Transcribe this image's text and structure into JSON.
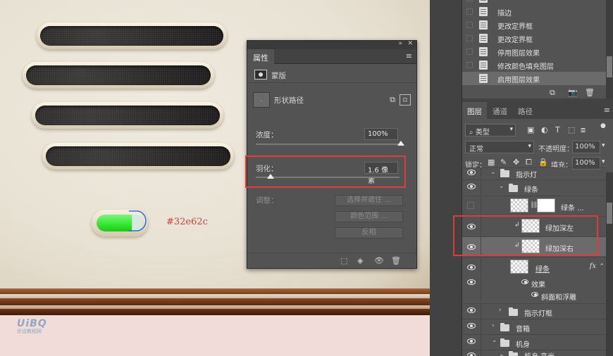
{
  "canvas": {
    "color_label": "#32e62c",
    "indicator_fill_color": "#32e62c",
    "indicator_level_percent": 75,
    "watermark": {
      "line1": "UiBQ",
      "line2": "优设教程网"
    }
  },
  "properties_panel": {
    "collapse_icon": "»",
    "close_icon": "✕",
    "tab_label": "属性",
    "section_label": "蒙版",
    "shape_thumb_label": ".",
    "shape_path_label": "形状路径",
    "density_label": "浓度：",
    "density_value": "100%",
    "density_level_percent": 100,
    "feather_label": "羽化：",
    "feather_value": "1.6 像素",
    "feather_level_percent": 10,
    "adjust_label": "调整：",
    "btn_select_mask": "选择并遮住 ...",
    "btn_color_range": "颜色范围 ...",
    "btn_invert": "反相"
  },
  "history_panel": {
    "items": [
      {
        "label": "描边"
      },
      {
        "label": "更改定界框"
      },
      {
        "label": "更改定界框"
      },
      {
        "label": "停用图层效果"
      },
      {
        "label": "修改颜色填充图层"
      },
      {
        "label": "启用图层效果",
        "selected": true
      }
    ]
  },
  "layers_panel": {
    "tabs": [
      {
        "label": "图层",
        "active": true
      },
      {
        "label": "通道"
      },
      {
        "label": "路径"
      }
    ],
    "filter_kind": "类型",
    "blend_mode": "正常",
    "opacity_label": "不透明度：",
    "opacity_value": "100%",
    "lock_label": "锁定：",
    "fill_label": "填充：",
    "fill_value": "100%",
    "layers": [
      {
        "name": "指示灯",
        "type": "group-partial",
        "visible": true
      },
      {
        "name": "绿条",
        "type": "group",
        "visible": true,
        "expanded": true
      },
      {
        "name": "绿条 ...",
        "type": "fill-mask",
        "visible": false
      },
      {
        "name": "绿加深左",
        "type": "clip-layer",
        "visible": true
      },
      {
        "name": "绿加深右",
        "type": "clip-layer",
        "visible": true,
        "selected": true
      },
      {
        "name": "绿条",
        "type": "layer-fx",
        "visible": true,
        "fx": "fx"
      },
      {
        "name": "效果",
        "type": "effects",
        "visible": true
      },
      {
        "name": "斜面和浮雕",
        "type": "effect",
        "visible": true
      },
      {
        "name": "指示灯框",
        "type": "group",
        "visible": true
      },
      {
        "name": "音箱",
        "type": "group",
        "visible": true
      },
      {
        "name": "机身",
        "type": "group",
        "visible": true,
        "expanded": true
      },
      {
        "name": "机身 高光",
        "type": "group",
        "visible": true,
        "expanded": true
      }
    ]
  }
}
